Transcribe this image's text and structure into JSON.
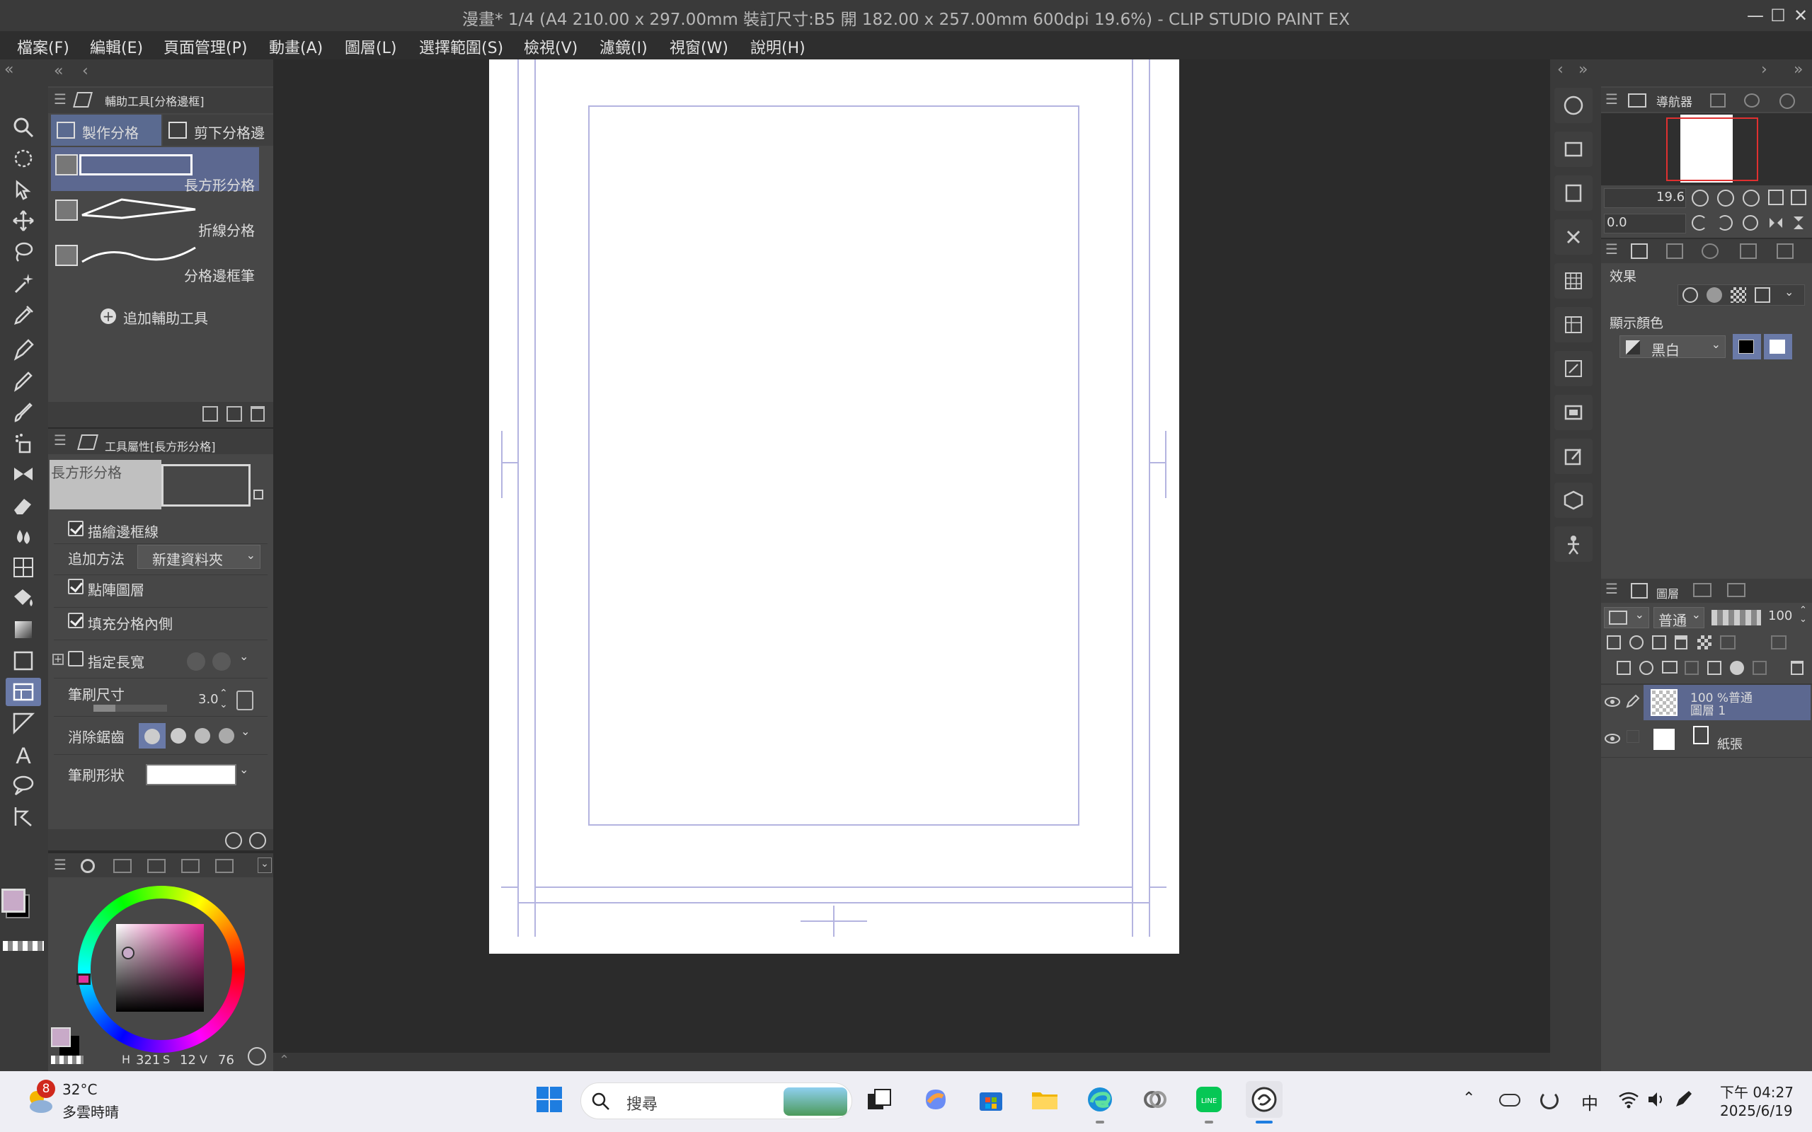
{
  "window": {
    "title": "漫畫* 1/4 (A4 210.00 x 297.00mm 裝訂尺寸:B5 開 182.00 x 257.00mm 600dpi 19.6%)  - CLIP STUDIO PAINT EX",
    "minimize": "—",
    "maximize": "☐",
    "close": "✕"
  },
  "menu": [
    "檔案(F)",
    "編輯(E)",
    "頁面管理(P)",
    "動畫(A)",
    "圖層(L)",
    "選擇範圍(S)",
    "檢視(V)",
    "濾鏡(I)",
    "視窗(W)",
    "說明(H)"
  ],
  "subtool_panel": {
    "title": "輔助工具[分格邊框]",
    "tabs": [
      "製作分格",
      "剪下分格邊"
    ],
    "items": [
      "長方形分格",
      "折線分格",
      "分格邊框筆"
    ],
    "add_label": "追加輔助工具"
  },
  "tool_property": {
    "title": "工具屬性[長方形分格]",
    "preview_label": "長方形分格",
    "draw_border": "描繪邊框線",
    "add_method_label": "追加方法",
    "add_method_value": "新建資料夾",
    "raster_layer": "點陣圖層",
    "fill_inside": "填充分格內側",
    "aspect": "指定長寬",
    "brush_size_label": "筆刷尺寸",
    "brush_size_value": "3.0",
    "antialias_label": "消除鋸齒",
    "brush_shape_label": "筆刷形狀"
  },
  "color": {
    "main": "#c8aac8",
    "sub": "#000000",
    "hue_indicator": "#e0309a",
    "h_label": "H",
    "h_value": "321",
    "s_label": "S",
    "s_value": "12",
    "v_label": "V",
    "v_value": "76"
  },
  "navigator": {
    "title": "導航器",
    "zoom": "19.6",
    "rotation": "0.0"
  },
  "layer_property": {
    "effect_label": "效果",
    "display_color_label": "顯示顏色",
    "display_color_value": "黑白"
  },
  "layers": {
    "title": "圖層",
    "blend_mode": "普通",
    "opacity": "100",
    "items": [
      {
        "line1": "100 %普通",
        "line2": "圖層 1"
      },
      {
        "line1": "",
        "line2": "紙張"
      }
    ]
  },
  "taskbar": {
    "badge": "8",
    "temperature": "32°C",
    "weather": "多雲時晴",
    "search": "搜尋",
    "ime": "中",
    "time": "下午 04:27",
    "date": "2025/6/19"
  }
}
